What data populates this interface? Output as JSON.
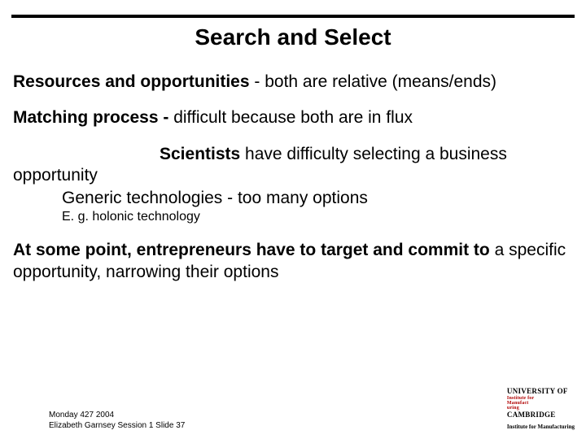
{
  "title": "Search and Select",
  "p1": {
    "lead": "Resources and opportunities",
    "rest": "  - both are relative (means/ends)"
  },
  "p2": {
    "lead": "Matching process - ",
    "rest": "difficult because both are in flux"
  },
  "p3": {
    "lead": "Scientists",
    "rest": " have difficulty selecting a business opportunity"
  },
  "p4": "Generic technologies -  too many options",
  "p5": "E. g. holonic technology",
  "p6": {
    "lead": "At some point, entrepreneurs have to target and commit to",
    "rest": " a specific opportunity, narrowing their options"
  },
  "footer": {
    "line1": "Monday 427 2004",
    "line2": "Elizabeth Garnsey Session 1 Slide 37"
  },
  "university": {
    "top": "UNIVERSITY OF",
    "mid1": "Institute for",
    "mid2": "Manufact",
    "mid3": "uring",
    "cam": "CAMBRIDGE",
    "inst": "Institute for Manufacturing"
  }
}
